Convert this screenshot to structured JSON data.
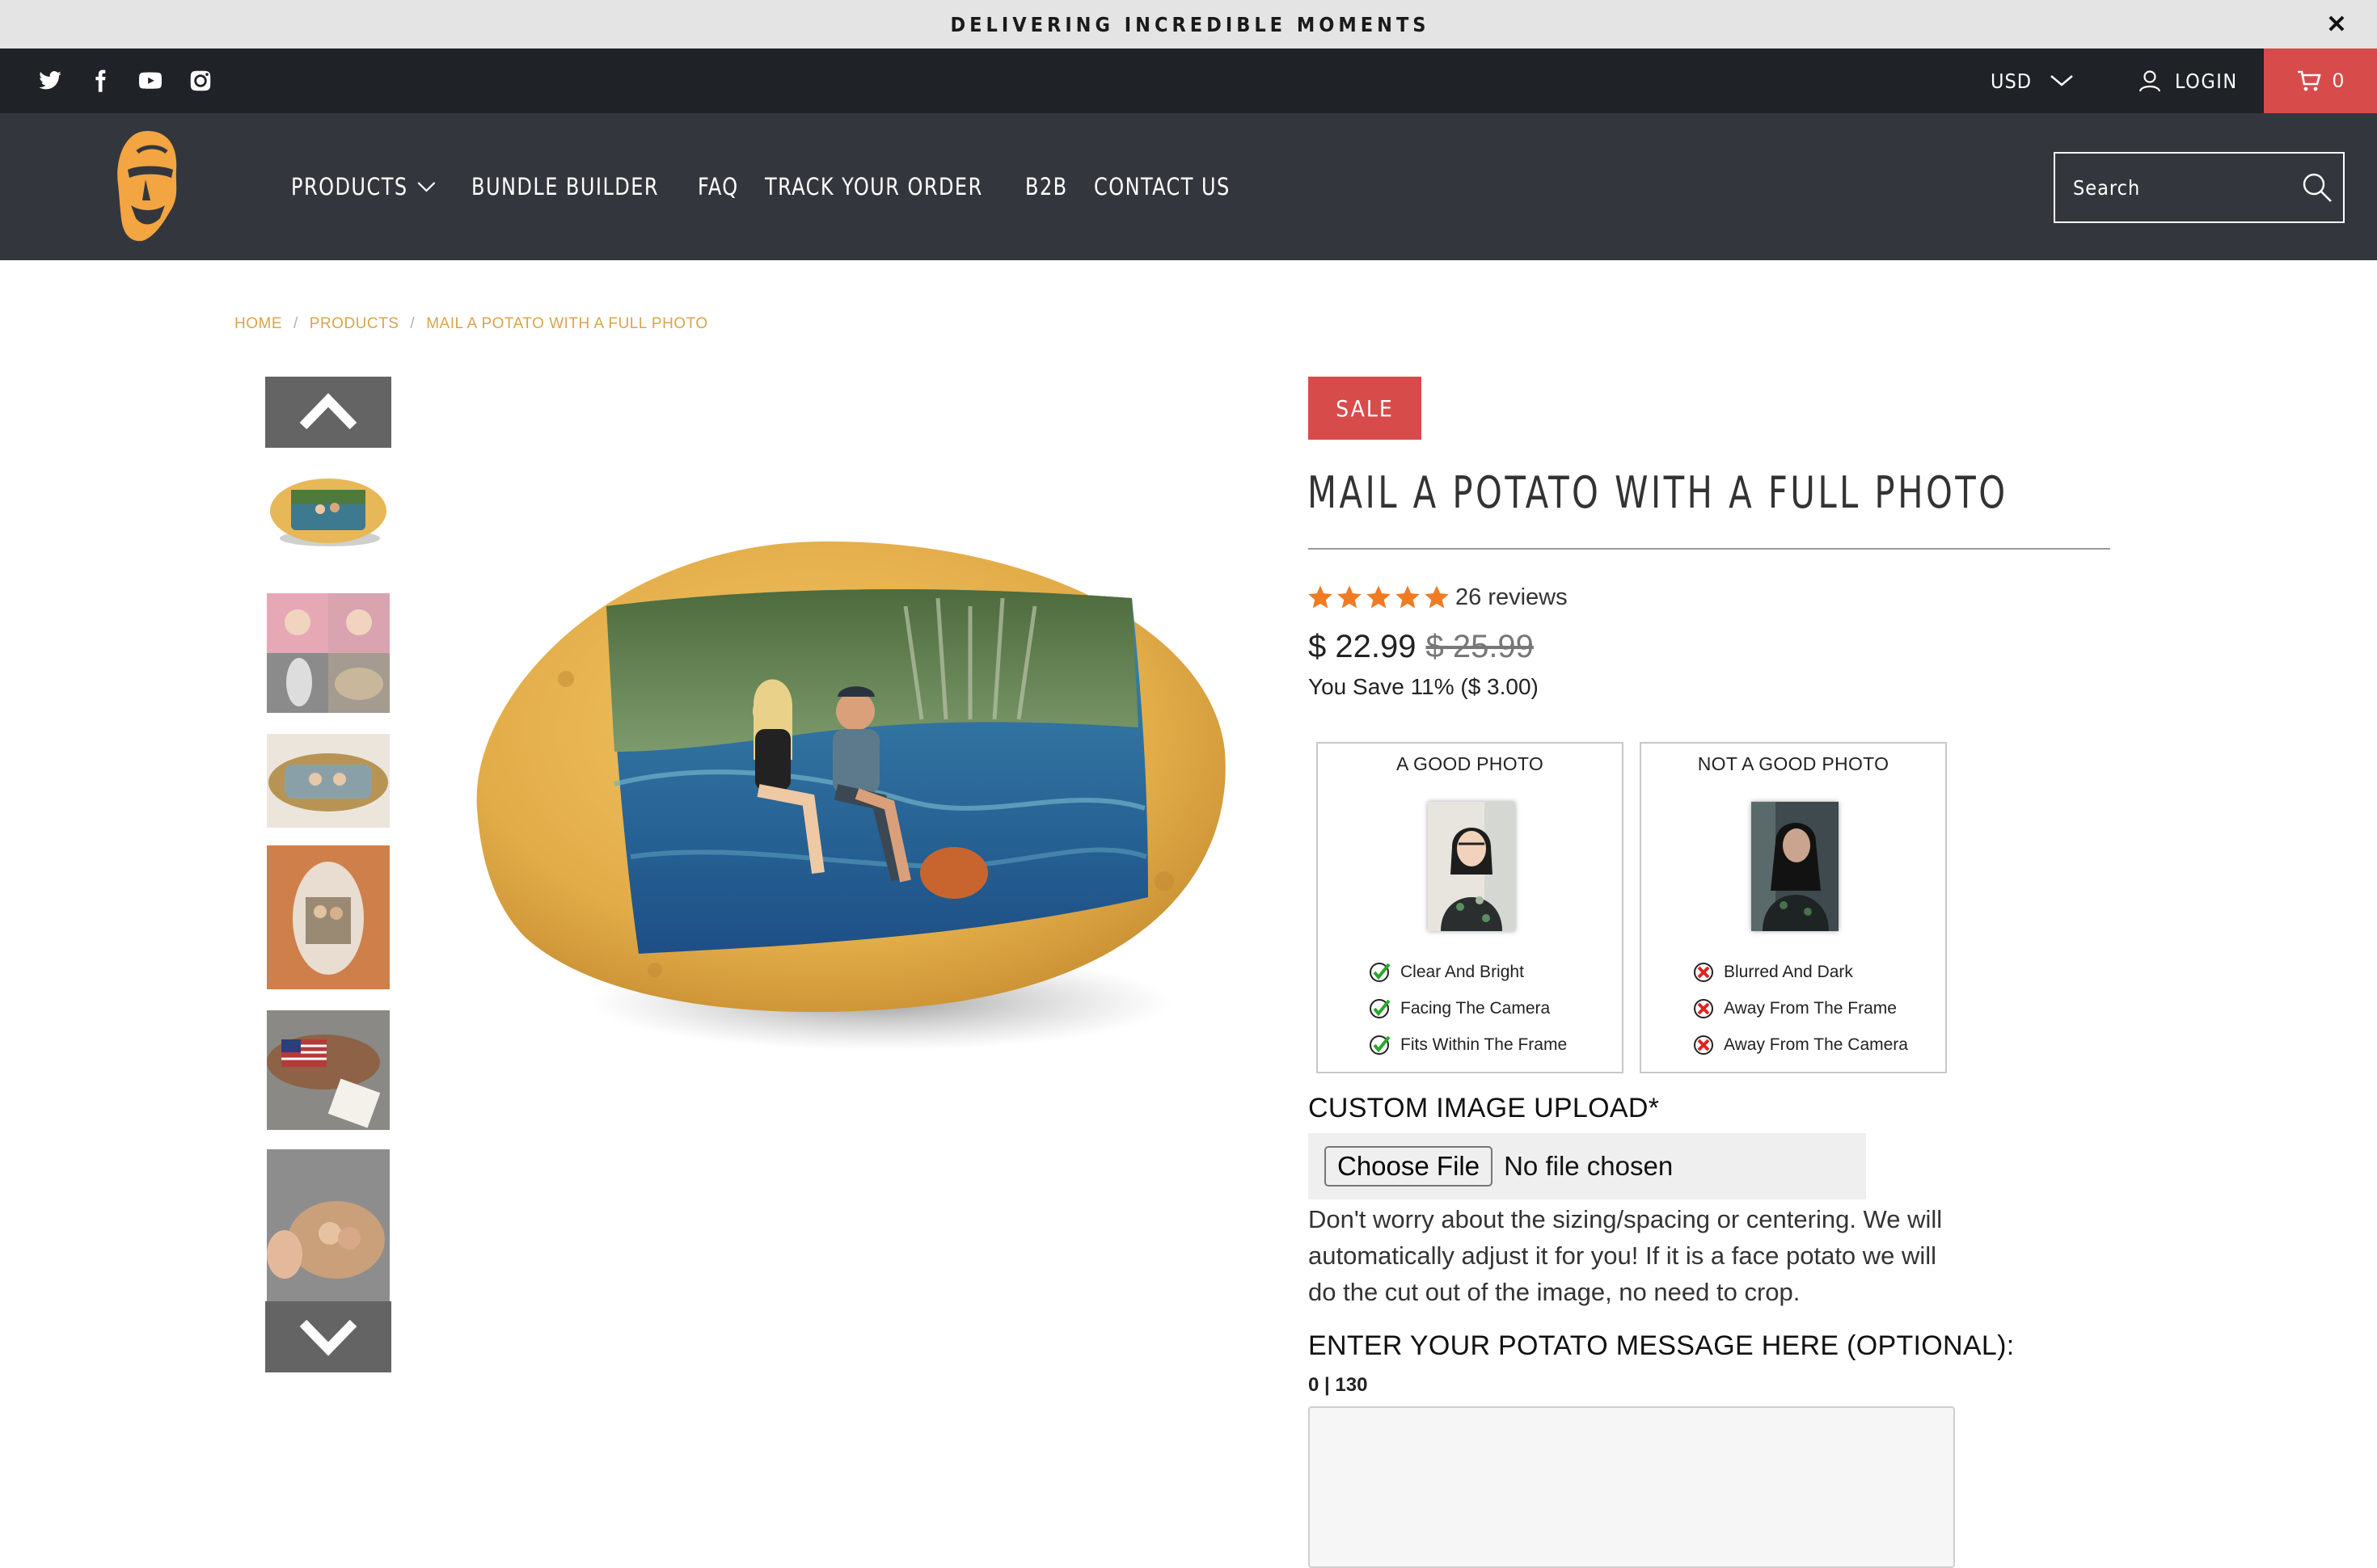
{
  "announcement": {
    "text": "DELIVERING INCREDIBLE MOMENTS",
    "close": "✕"
  },
  "topbar": {
    "social_icons": [
      "twitter-icon",
      "facebook-icon",
      "youtube-icon",
      "instagram-icon"
    ],
    "currency": "USD",
    "login": "LOGIN",
    "cart_count": "0"
  },
  "nav": {
    "items": [
      {
        "label": "PRODUCTS",
        "has_dropdown": true
      },
      {
        "label": "BUNDLE BUILDER"
      },
      {
        "label": "FAQ"
      },
      {
        "label": "TRACK YOUR ORDER"
      },
      {
        "label": "B2B"
      },
      {
        "label": "CONTACT US"
      }
    ],
    "search_placeholder": "Search"
  },
  "breadcrumb": {
    "home": "HOME",
    "products": "PRODUCTS",
    "current": "MAIL A POTATO WITH A FULL PHOTO",
    "separator": "/"
  },
  "product": {
    "badge": "SALE",
    "title": "MAIL A POTATO WITH A FULL PHOTO",
    "rating": 5,
    "reviews": "26 reviews",
    "price": "$ 22.99",
    "compare_price": "$ 25.99",
    "savings": "You Save 11% ($ 3.00)"
  },
  "photo_guide": {
    "good": {
      "title": "A GOOD PHOTO",
      "points": [
        "Clear And Bright",
        "Facing The Camera",
        "Fits Within The Frame"
      ]
    },
    "bad": {
      "title": "NOT A GOOD PHOTO",
      "points": [
        "Blurred And Dark",
        "Away From The Frame",
        "Away From The Camera"
      ]
    }
  },
  "upload": {
    "label": "CUSTOM IMAGE UPLOAD*",
    "button": "Choose File",
    "status": "No file chosen",
    "note": "Don't worry about the sizing/spacing or centering. We will automatically adjust it for you! If it is a face potato we will do the cut out of the image, no need to crop."
  },
  "message": {
    "label": "ENTER YOUR POTATO MESSAGE HERE (OPTIONAL):",
    "counter": "0 | 130",
    "value": ""
  },
  "colors": {
    "accent_red": "#d84b4b",
    "breadcrumb_gold": "#d9a44a",
    "star_orange": "#f07b22",
    "nav_bg": "#33373d",
    "topbar_bg": "#1f2227"
  }
}
